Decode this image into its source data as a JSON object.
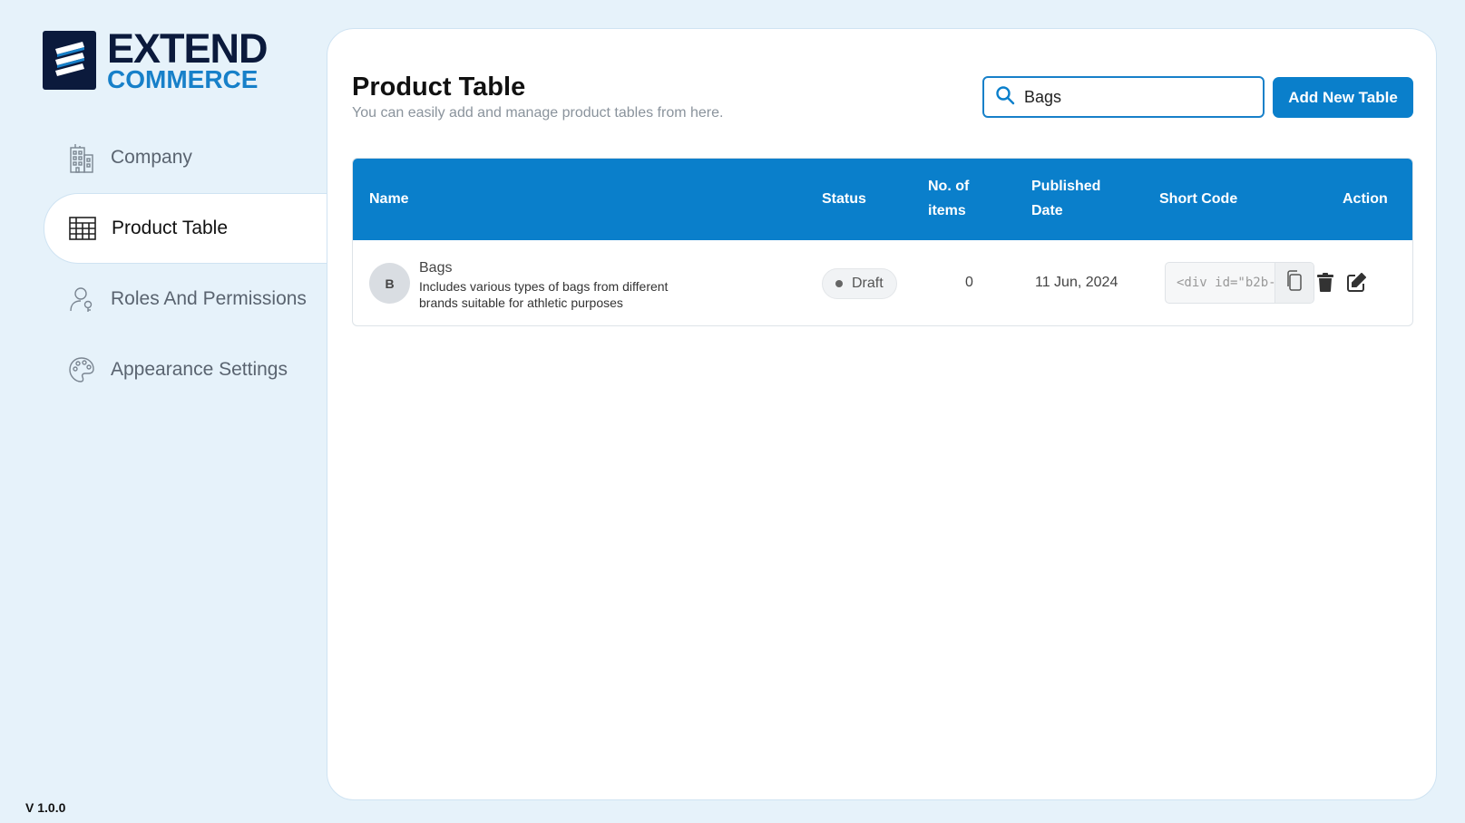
{
  "brand": {
    "line1": "EXTEND",
    "line2": "COMMERCE"
  },
  "sidebar": {
    "items": [
      {
        "label": "Company",
        "icon": "building-icon",
        "active": false
      },
      {
        "label": "Product Table",
        "icon": "table-grid-icon",
        "active": true
      },
      {
        "label": "Roles And Permissions",
        "icon": "user-key-icon",
        "active": false
      },
      {
        "label": "Appearance Settings",
        "icon": "palette-icon",
        "active": false
      }
    ]
  },
  "version": "V 1.0.0",
  "header": {
    "title": "Product Table",
    "subtitle": "You can easily add and manage product tables from here."
  },
  "search": {
    "value": "Bags",
    "icon": "search-icon"
  },
  "add_button": {
    "label": "Add New Table"
  },
  "table": {
    "columns": {
      "name": "Name",
      "status": "Status",
      "items_line1": "No. of",
      "items_line2": "items",
      "date_line1": "Published",
      "date_line2": "Date",
      "shortcode": "Short Code",
      "action": "Action"
    },
    "rows": [
      {
        "initial": "B",
        "name": "Bags",
        "description": "Includes various types of bags from different brands suitable for athletic purposes",
        "status": "Draft",
        "items": "0",
        "date": "11 Jun, 2024",
        "shortcode": "<div id=\"b2b-"
      }
    ]
  },
  "colors": {
    "accent": "#0a7fcb",
    "brand_dark": "#0b1a3c",
    "background": "#e6f2fa"
  }
}
